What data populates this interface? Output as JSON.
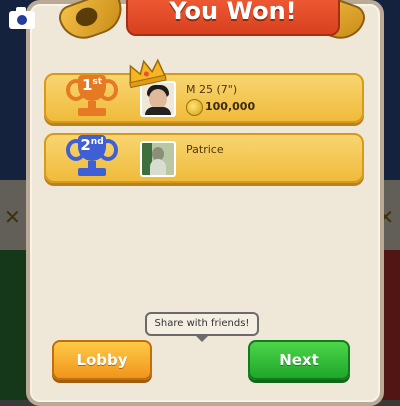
{
  "banner": {
    "title": "You Won!"
  },
  "results": [
    {
      "rank_num": "1",
      "rank_suffix": "st",
      "player_name": "M 25 (7\")",
      "coins": "100,000",
      "trophy_color": "#e57a23",
      "has_crown": true
    },
    {
      "rank_num": "2",
      "rank_suffix": "nd",
      "player_name": "Patrice",
      "trophy_color": "#3f5fd4",
      "has_crown": false
    }
  ],
  "share": {
    "tooltip": "Share with friends!",
    "icon": "camera-icon"
  },
  "buttons": {
    "lobby_label": "Lobby",
    "next_label": "Next"
  },
  "colors": {
    "banner": "#e54b27",
    "row": "#f3c94f",
    "lobby": "#f5a623",
    "next": "#2cbf36",
    "share": "#2c4fc0"
  }
}
